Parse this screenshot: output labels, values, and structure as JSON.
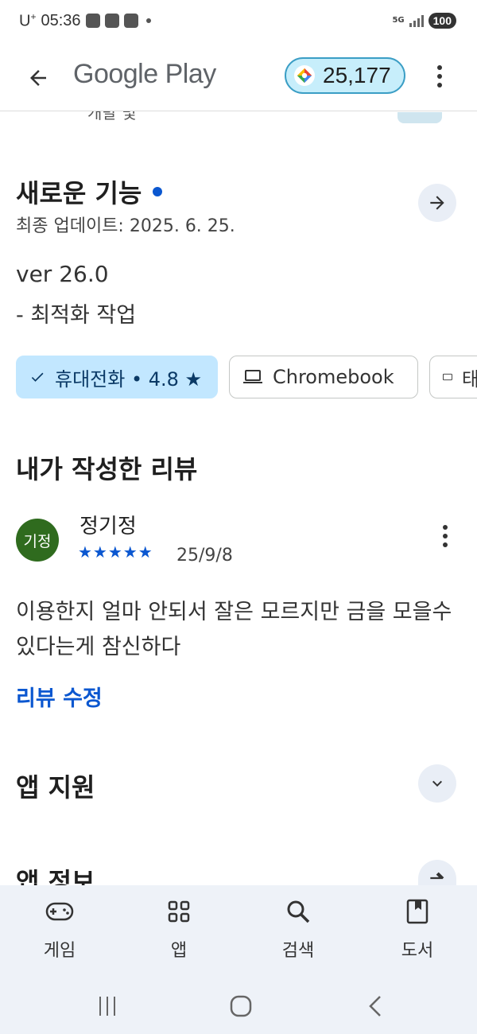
{
  "status_bar": {
    "carrier": "U",
    "carrier_sup": "+",
    "time": "05:36",
    "network": "5G",
    "battery": "100"
  },
  "app_bar": {
    "title": "Google Play",
    "points": "25,177"
  },
  "clipped_above": "개발 및",
  "whats_new": {
    "title": "새로운 기능",
    "last_updated": "최종 업데이트: 2025. 6. 25.",
    "version": "ver 26.0",
    "notes": "- 최적화 작업"
  },
  "device_chips": [
    {
      "label": "휴대전화 • 4.8 ★",
      "selected": true,
      "icon": "check-icon"
    },
    {
      "label": "Chromebook",
      "selected": false,
      "icon": "laptop-icon"
    },
    {
      "label": "태",
      "selected": false,
      "icon": "tablet-icon"
    }
  ],
  "my_review": {
    "heading": "내가 작성한 리뷰",
    "avatar_text": "기정",
    "reviewer": "정기정",
    "stars": "★★★★★",
    "rating": 5,
    "date": "25/9/8",
    "body": "이용한지 얼마 안되서 잘은 모르지만 금을 모을수 있다는게 참신하다",
    "edit_label": "리뷰 수정"
  },
  "app_support": {
    "title": "앱 지원"
  },
  "app_info": {
    "title": "앱 정보"
  },
  "bottom_nav": [
    {
      "label": "게임",
      "icon": "gamepad-icon"
    },
    {
      "label": "앱",
      "icon": "apps-grid-icon"
    },
    {
      "label": "검색",
      "icon": "search-icon"
    },
    {
      "label": "도서",
      "icon": "book-icon"
    }
  ],
  "colors": {
    "accent": "#0b57d0",
    "chip_selected": "#c2e7ff",
    "points_bg": "#c7eefb",
    "avatar": "#2f6b1e",
    "nav_bg": "#eef2f8"
  }
}
